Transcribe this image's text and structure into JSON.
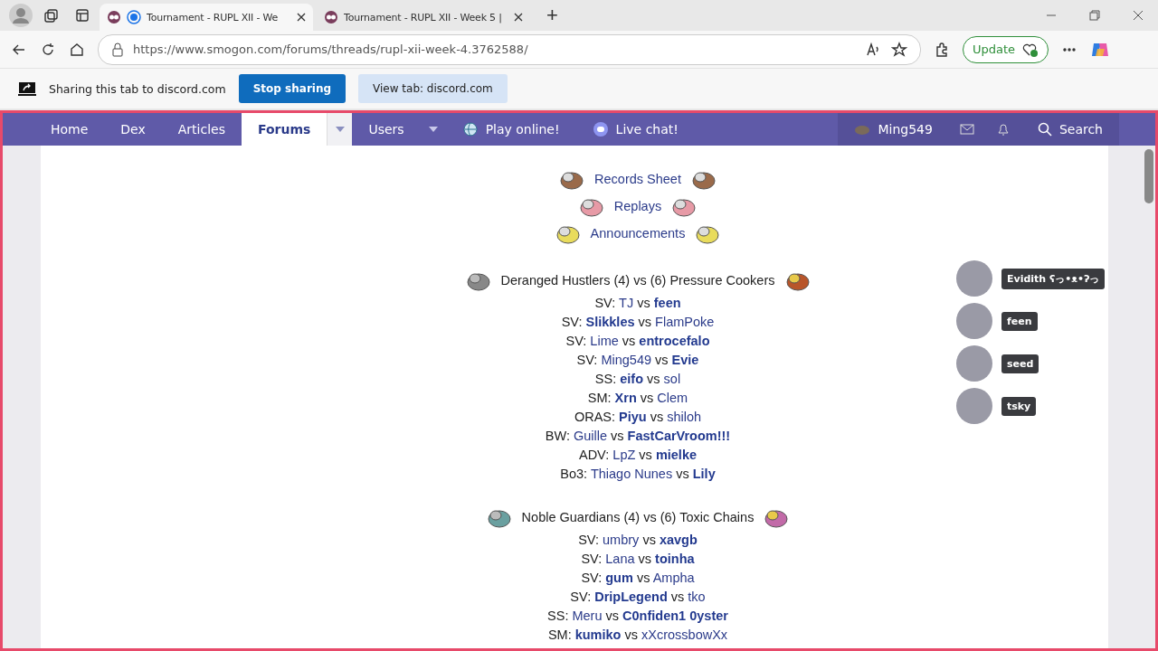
{
  "browser": {
    "tabs": [
      {
        "title": "Tournament - RUPL XII - We",
        "selected": true,
        "sharing": true
      },
      {
        "title": "Tournament - RUPL XII - Week 5 |",
        "selected": false,
        "sharing": false
      }
    ],
    "new_tab": "+",
    "url": "https://www.smogon.com/forums/threads/rupl-xii-week-4.3762588/",
    "update_button": "Update"
  },
  "sharing_bar": {
    "message": "Sharing this tab to discord.com",
    "stop_button": "Stop sharing",
    "view_button": "View tab: discord.com"
  },
  "nav": {
    "items": [
      {
        "label": "Home",
        "selected": false,
        "dropdown": false,
        "kind": "plain"
      },
      {
        "label": "Dex",
        "selected": false,
        "dropdown": false,
        "kind": "plain"
      },
      {
        "label": "Articles",
        "selected": false,
        "dropdown": false,
        "kind": "plain"
      },
      {
        "label": "Forums",
        "selected": true,
        "dropdown": true,
        "kind": "plain"
      },
      {
        "label": "Users",
        "selected": false,
        "dropdown": true,
        "kind": "plain"
      },
      {
        "label": "Play online!",
        "selected": false,
        "dropdown": false,
        "kind": "play"
      },
      {
        "label": "Live chat!",
        "selected": false,
        "dropdown": false,
        "kind": "chat"
      }
    ],
    "user": "Ming549",
    "search": "Search"
  },
  "links": [
    "Records Sheet",
    "Replays",
    "Announcements"
  ],
  "matchups": [
    {
      "title": "Deranged Hustlers (4) vs (6) Pressure Cookers",
      "matches": [
        {
          "tier": "SV:",
          "p1": {
            "name": "TJ",
            "won": false
          },
          "vs": "vs",
          "p2": {
            "name": "feen",
            "won": true
          }
        },
        {
          "tier": "SV:",
          "p1": {
            "name": "Slikkles",
            "won": true
          },
          "vs": "vs",
          "p2": {
            "name": "FlamPoke",
            "won": false
          }
        },
        {
          "tier": "SV:",
          "p1": {
            "name": "Lime",
            "won": false
          },
          "vs": "vs",
          "p2": {
            "name": "entrocefalo",
            "won": true
          }
        },
        {
          "tier": "SV:",
          "p1": {
            "name": "Ming549",
            "won": false
          },
          "vs": "vs",
          "p2": {
            "name": "Evie",
            "won": true
          }
        },
        {
          "tier": "SS:",
          "p1": {
            "name": "eifo",
            "won": true
          },
          "vs": "vs",
          "p2": {
            "name": "sol",
            "won": false
          }
        },
        {
          "tier": "SM:",
          "p1": {
            "name": "Xrn",
            "won": true
          },
          "vs": "vs",
          "p2": {
            "name": "Clem",
            "won": false
          }
        },
        {
          "tier": "ORAS:",
          "p1": {
            "name": "Piyu",
            "won": true
          },
          "vs": "vs",
          "p2": {
            "name": "shiloh",
            "won": false
          }
        },
        {
          "tier": "BW:",
          "p1": {
            "name": "Guille",
            "won": false
          },
          "vs": "vs",
          "p2": {
            "name": "FastCarVroom!!!",
            "won": true
          }
        },
        {
          "tier": "ADV:",
          "p1": {
            "name": "LpZ",
            "won": false
          },
          "vs": "vs",
          "p2": {
            "name": "mielke",
            "won": true
          }
        },
        {
          "tier": "Bo3:",
          "p1": {
            "name": "Thiago Nunes",
            "won": false
          },
          "vs": "vs",
          "p2": {
            "name": "Lily",
            "won": true
          }
        }
      ]
    },
    {
      "title": "Noble Guardians (4) vs (6) Toxic Chains",
      "matches": [
        {
          "tier": "SV:",
          "p1": {
            "name": "umbry",
            "won": false
          },
          "vs": "vs",
          "p2": {
            "name": "xavgb",
            "won": true
          }
        },
        {
          "tier": "SV:",
          "p1": {
            "name": "Lana",
            "won": false
          },
          "vs": "vs",
          "p2": {
            "name": "toinha",
            "won": true
          }
        },
        {
          "tier": "SV:",
          "p1": {
            "name": "gum",
            "won": true
          },
          "vs": "vs",
          "p2": {
            "name": "Ampha",
            "won": false
          }
        },
        {
          "tier": "SV:",
          "p1": {
            "name": "DripLegend",
            "won": true
          },
          "vs": "vs",
          "p2": {
            "name": "tko",
            "won": false
          }
        },
        {
          "tier": "SS:",
          "p1": {
            "name": "Meru",
            "won": false
          },
          "vs": "vs",
          "p2": {
            "name": "C0nfiden1 0yster",
            "won": true
          }
        },
        {
          "tier": "SM:",
          "p1": {
            "name": "kumiko",
            "won": true
          },
          "vs": "vs",
          "p2": {
            "name": "xXcrossbowXx",
            "won": false
          }
        }
      ]
    }
  ],
  "voice_overlay": {
    "speakers": [
      {
        "name": "Evidith ʕっ•ᴥ•ʔっ"
      },
      {
        "name": "feen"
      },
      {
        "name": "seed"
      },
      {
        "name": "tsky"
      }
    ]
  }
}
